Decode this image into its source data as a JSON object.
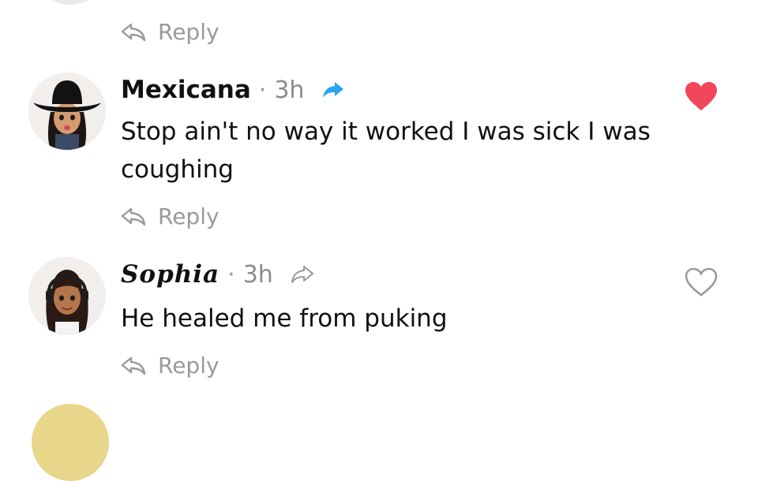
{
  "comments": [
    {
      "author": "Mexicana",
      "separator": "·",
      "time": "3h",
      "text": "Stop ain't no way it worked I was sick I was coughing",
      "liked": true,
      "reply_label": "Reply"
    },
    {
      "author": "Sophia",
      "separator": "·",
      "time": "3h",
      "text": "He healed me from puking",
      "liked": false,
      "reply_label": "Reply"
    }
  ],
  "top_reply_label": "Reply",
  "colors": {
    "liked_heart": "#f2465a",
    "share_active": "#2aa4ef",
    "muted": "#9a9a9a"
  },
  "icons": [
    "reply-icon",
    "share-icon",
    "heart-icon",
    "avatar"
  ]
}
